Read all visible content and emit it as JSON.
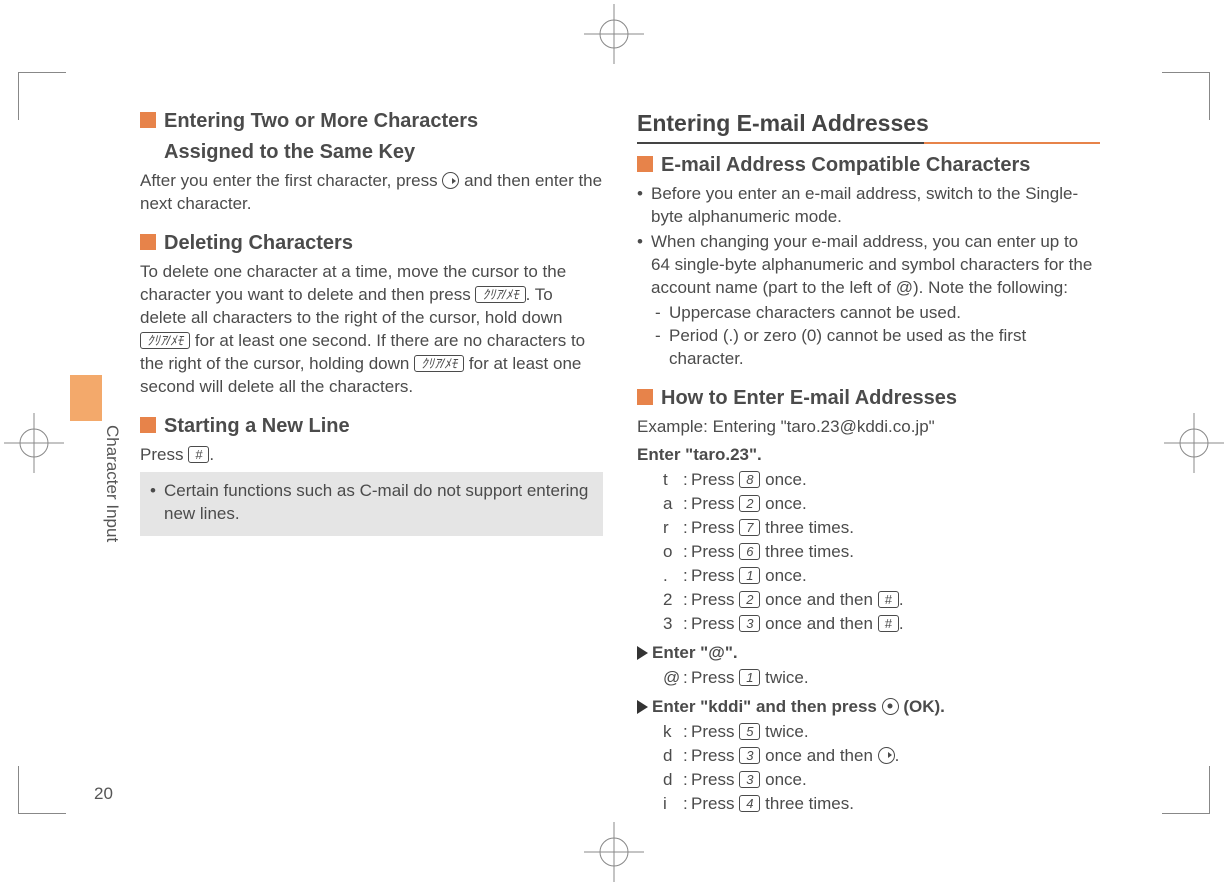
{
  "page_number": "20",
  "sidebar_label": "Character Input",
  "keys": {
    "clear": "ｸﾘｱ/ﾒﾓ",
    "hash": "#",
    "k1": "1",
    "k2": "2",
    "k3": "3",
    "k4": "4",
    "k5": "5",
    "k6": "6",
    "k7": "7",
    "k8": "8"
  },
  "left": {
    "s1_title_l1": "Entering Two or More Characters",
    "s1_title_l2": "Assigned to the Same Key",
    "s1_body_a": "After you enter the first character, press ",
    "s1_body_b": " and then enter the next character.",
    "s2_title": "Deleting Characters",
    "s2_body_a": "To delete one character at a time, move the cursor to the character you want to delete and then press ",
    "s2_body_b": ". To delete all characters to the right of the cursor, hold down ",
    "s2_body_c": " for at least one second. If there are no characters to the right of the cursor, holding down ",
    "s2_body_d": " for at least one second will delete all the characters.",
    "s3_title": "Starting a New Line",
    "s3_body_a": "Press ",
    "s3_body_b": ".",
    "note_bullet": "•",
    "note": "Certain functions such as C-mail do not support entering new lines."
  },
  "right": {
    "h1": "Entering E-mail Addresses",
    "s1_title": "E-mail Address Compatible Characters",
    "b1": "Before you enter an e-mail address, switch to the Single-byte alphanumeric mode.",
    "b2": "When changing your e-mail address, you can enter up to 64 single-byte alphanumeric and symbol characters for the account name (part to the left of @). Note the following:",
    "d1": "Uppercase characters cannot be used.",
    "d2": "Period (.) or zero (0) cannot be used as the first character.",
    "s2_title": "How to Enter E-mail Addresses",
    "ex": "Example: Entering \"taro.23@kddi.co.jp\"",
    "step1": "Enter \"taro.23\".",
    "step2": "Enter \"@\".",
    "step3a": "Enter \"kddi\" and then press ",
    "step3b": " (OK).",
    "rows1": [
      {
        "k": "t",
        "pre": "Press ",
        "key": "k8",
        "post": " once."
      },
      {
        "k": "a",
        "pre": "Press ",
        "key": "k2",
        "post": " once."
      },
      {
        "k": "r",
        "pre": "Press ",
        "key": "k7",
        "post": " three times."
      },
      {
        "k": "o",
        "pre": "Press ",
        "key": "k6",
        "post": " three times."
      },
      {
        "k": ".",
        "pre": "Press ",
        "key": "k1",
        "post": " once."
      },
      {
        "k": "2",
        "pre": "Press ",
        "key": "k2",
        "post": " once and then ",
        "key2": "hash",
        "post2": "."
      },
      {
        "k": "3",
        "pre": "Press ",
        "key": "k3",
        "post": " once and then ",
        "key2": "hash",
        "post2": "."
      }
    ],
    "rows2": [
      {
        "k": "@",
        "pre": "Press ",
        "key": "k1",
        "post": " twice."
      }
    ],
    "rows3": [
      {
        "k": "k",
        "pre": "Press ",
        "key": "k5",
        "post": " twice."
      },
      {
        "k": "d",
        "pre": "Press ",
        "key": "k3",
        "post": " once and then ",
        "icon": "right",
        "post2": "."
      },
      {
        "k": "d",
        "pre": "Press ",
        "key": "k3",
        "post": " once."
      },
      {
        "k": "i",
        "pre": "Press ",
        "key": "k4",
        "post": " three times."
      }
    ]
  }
}
